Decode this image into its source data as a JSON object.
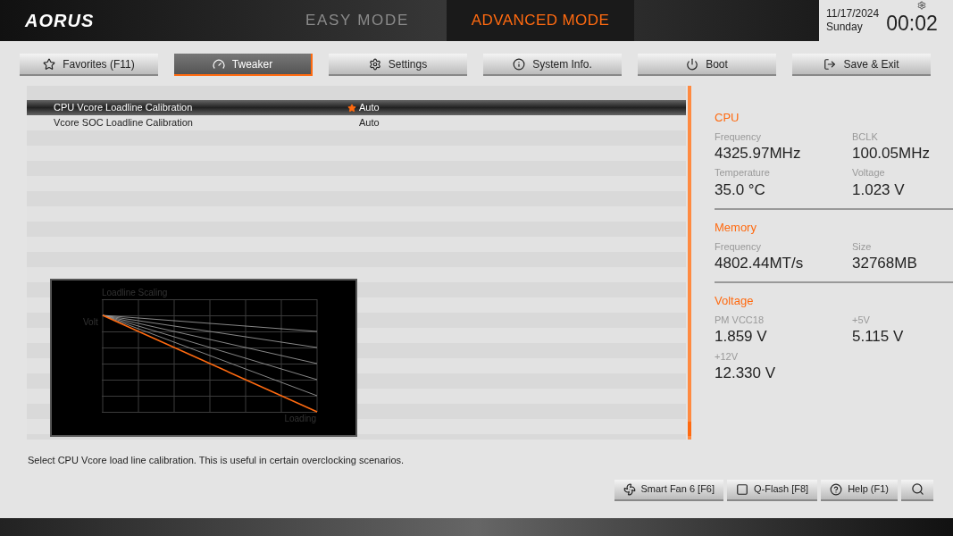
{
  "header": {
    "logo": "AORUS",
    "modes": [
      {
        "label": "EASY MODE",
        "selected": false
      },
      {
        "label": "ADVANCED MODE",
        "selected": true
      }
    ],
    "date": "11/17/2024",
    "day": "Sunday",
    "time": "00:02"
  },
  "tabs": [
    {
      "label": "Favorites (F11)",
      "selected": false
    },
    {
      "label": "Tweaker",
      "selected": true
    },
    {
      "label": "Settings",
      "selected": false
    },
    {
      "label": "System Info.",
      "selected": false
    },
    {
      "label": "Boot",
      "selected": false
    },
    {
      "label": "Save & Exit",
      "selected": false
    }
  ],
  "settings": [
    {
      "name": "CPU Vcore Loadline Calibration",
      "value": "Auto",
      "selected": true,
      "favorite": true
    },
    {
      "name": "Vcore SOC Loadline Calibration",
      "value": "Auto",
      "selected": false,
      "favorite": false
    }
  ],
  "chart": {
    "title": "Loadline Scaling",
    "ylabel": "Volt",
    "xlabel": "Loading"
  },
  "info": [
    {
      "title": "CPU",
      "fields": [
        {
          "label": "Frequency",
          "value": "4325.97MHz"
        },
        {
          "label": "BCLK",
          "value": "100.05MHz"
        },
        {
          "label": "Temperature",
          "value": "35.0 °C"
        },
        {
          "label": "Voltage",
          "value": "1.023 V"
        }
      ]
    },
    {
      "title": "Memory",
      "fields": [
        {
          "label": "Frequency",
          "value": "4802.44MT/s"
        },
        {
          "label": "Size",
          "value": "32768MB"
        }
      ]
    },
    {
      "title": "Voltage",
      "fields": [
        {
          "label": "PM VCC18",
          "value": "1.859 V"
        },
        {
          "label": "+5V",
          "value": "5.115 V"
        },
        {
          "label": "+12V",
          "value": "12.330 V"
        }
      ]
    }
  ],
  "description": "Select CPU Vcore load line calibration. This is useful in certain overclocking scenarios.",
  "bottom_buttons": [
    {
      "label": "Smart Fan 6 [F6]"
    },
    {
      "label": "Q-Flash [F8]"
    },
    {
      "label": "Help (F1)"
    }
  ]
}
